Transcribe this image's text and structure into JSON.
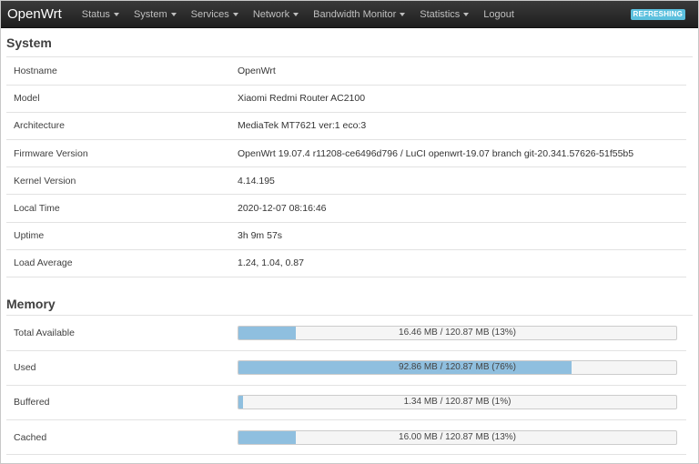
{
  "navbar": {
    "brand": "OpenWrt",
    "menu": [
      {
        "label": "Status",
        "dropdown": true
      },
      {
        "label": "System",
        "dropdown": true
      },
      {
        "label": "Services",
        "dropdown": true
      },
      {
        "label": "Network",
        "dropdown": true
      },
      {
        "label": "Bandwidth Monitor",
        "dropdown": true
      },
      {
        "label": "Statistics",
        "dropdown": true
      },
      {
        "label": "Logout",
        "dropdown": false
      }
    ],
    "status_badge": "REFRESHING",
    "badge_color": "#5bc0de"
  },
  "system": {
    "title": "System",
    "rows": [
      {
        "key": "Hostname",
        "value": "OpenWrt"
      },
      {
        "key": "Model",
        "value": "Xiaomi Redmi Router AC2100"
      },
      {
        "key": "Architecture",
        "value": "MediaTek MT7621 ver:1 eco:3"
      },
      {
        "key": "Firmware Version",
        "value": "OpenWrt 19.07.4 r11208-ce6496d796 / LuCI openwrt-19.07 branch git-20.341.57626-51f55b5"
      },
      {
        "key": "Kernel Version",
        "value": "4.14.195"
      },
      {
        "key": "Local Time",
        "value": "2020-12-07 08:16:46"
      },
      {
        "key": "Uptime",
        "value": "3h 9m 57s"
      },
      {
        "key": "Load Average",
        "value": "1.24, 1.04, 0.87"
      }
    ]
  },
  "memory": {
    "title": "Memory",
    "bar_color": "#8fbfdf",
    "rows": [
      {
        "key": "Total Available",
        "text": "16.46 MB / 120.87 MB (13%)",
        "percent": 13
      },
      {
        "key": "Used",
        "text": "92.86 MB / 120.87 MB (76%)",
        "percent": 76
      },
      {
        "key": "Buffered",
        "text": "1.34 MB / 120.87 MB (1%)",
        "percent": 1
      },
      {
        "key": "Cached",
        "text": "16.00 MB / 120.87 MB (13%)",
        "percent": 13
      }
    ]
  }
}
